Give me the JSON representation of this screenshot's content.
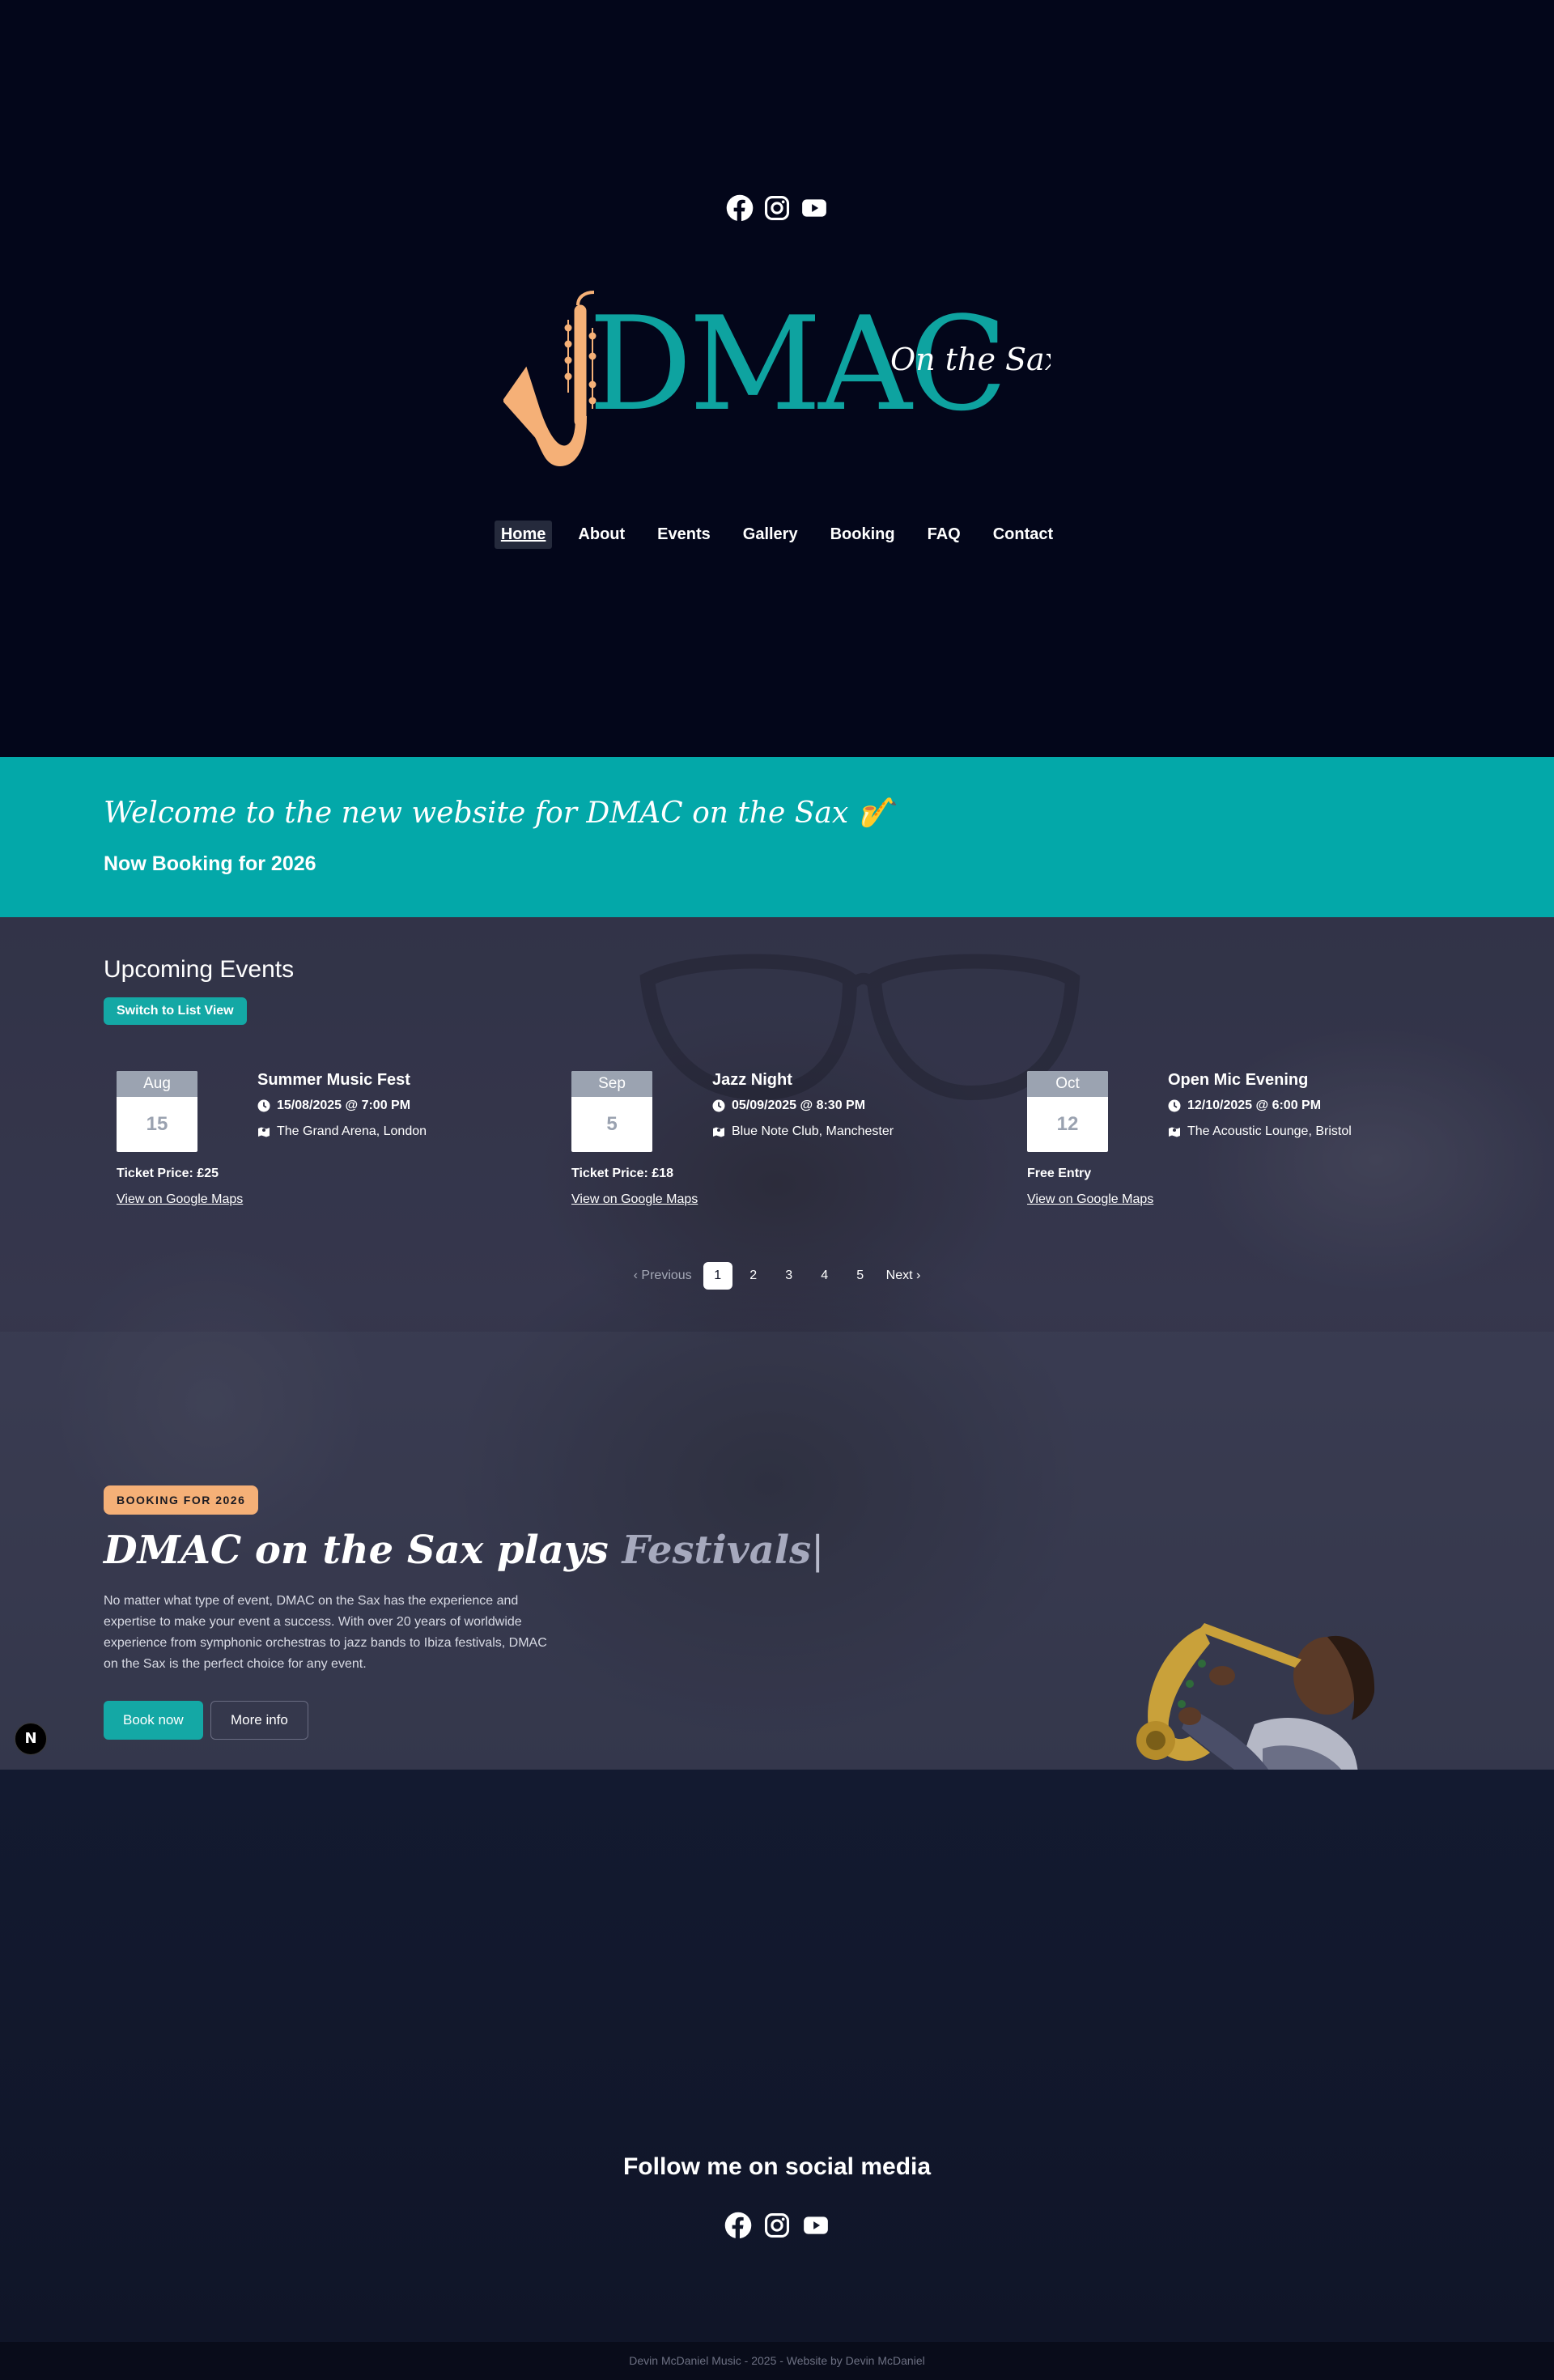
{
  "header": {
    "logo": {
      "wordmark": "DMAC",
      "tagline": "On the Sax"
    },
    "social_icons": [
      "facebook-icon",
      "instagram-icon",
      "youtube-icon"
    ],
    "nav": [
      {
        "label": "Home",
        "active": true
      },
      {
        "label": "About"
      },
      {
        "label": "Events"
      },
      {
        "label": "Gallery"
      },
      {
        "label": "Booking"
      },
      {
        "label": "FAQ"
      },
      {
        "label": "Contact"
      }
    ]
  },
  "banner": {
    "title": "Welcome to the new website for DMAC on the Sax 🎷",
    "subtitle": "Now Booking for 2026"
  },
  "events": {
    "title": "Upcoming Events",
    "switch_label": "Switch to List View",
    "items": [
      {
        "month": "Aug",
        "day": "15",
        "title": "Summer Music Fest",
        "datetime": "15/08/2025 @ 7:00 PM",
        "venue": "The Grand Arena, London",
        "price": "Ticket Price: £25",
        "map_link": "View on Google Maps"
      },
      {
        "month": "Sep",
        "day": "5",
        "title": "Jazz Night",
        "datetime": "05/09/2025 @ 8:30 PM",
        "venue": "Blue Note Club, Manchester",
        "price": "Ticket Price: £18",
        "map_link": "View on Google Maps"
      },
      {
        "month": "Oct",
        "day": "12",
        "title": "Open Mic Evening",
        "datetime": "12/10/2025 @ 6:00 PM",
        "venue": "The Acoustic Lounge, Bristol",
        "price": "Free Entry",
        "map_link": "View on Google Maps"
      }
    ],
    "pagination": {
      "prev": "Previous",
      "next": "Next",
      "pages": [
        "1",
        "2",
        "3",
        "4",
        "5"
      ],
      "current": "1"
    }
  },
  "hero": {
    "badge": "BOOKING FOR 2026",
    "title_prefix": "DMAC on the Sax plays",
    "title_word": "Festivals",
    "text": "No matter what type of event, DMAC on the Sax has the experience and expertise to make your event a success. With over 20 years of worldwide experience from symphonic orchestras to jazz bands to Ibiza festivals, DMAC on the Sax is the perfect choice for any event.",
    "book_label": "Book now",
    "more_label": "More info"
  },
  "dev_badge": "N",
  "follow": {
    "title": "Follow me on social media",
    "icons": [
      "facebook-icon",
      "instagram-icon",
      "youtube-icon"
    ]
  },
  "footer": {
    "text": "Devin McDaniel Music - 2025 - Website by Devin McDaniel"
  },
  "colors": {
    "header_bg": "#03061a",
    "teal": "#03a8a9",
    "button_teal": "#14a8a5",
    "logo_orange": "#f5b077",
    "badge_orange": "#f5b077"
  }
}
